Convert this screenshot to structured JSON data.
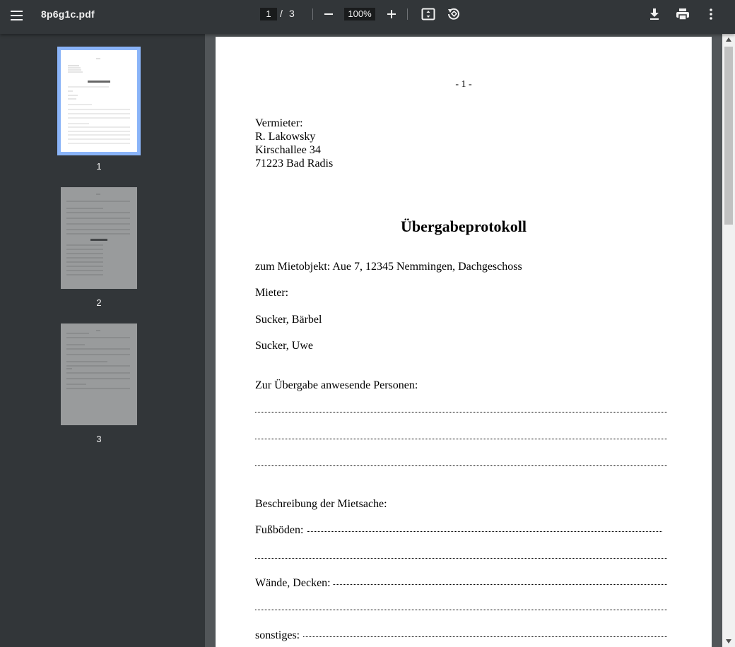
{
  "toolbar": {
    "filename": "8p6g1c.pdf",
    "current_page": "1",
    "page_separator": "/",
    "total_pages": "3",
    "zoom": "100%",
    "icons": [
      "menu-icon",
      "zoom-out-icon",
      "zoom-in-icon",
      "fit-page-icon",
      "rotate-icon",
      "download-icon",
      "print-icon",
      "more-vert-icon"
    ]
  },
  "sidebar": {
    "thumbnails": [
      {
        "label": "1"
      },
      {
        "label": "2"
      },
      {
        "label": "3"
      }
    ]
  },
  "document": {
    "page_number": "- 1 -",
    "landlord": {
      "heading": "Vermieter:",
      "name": "R. Lakowsky",
      "street": "Kirschallee 34",
      "city": "71223 Bad Radis"
    },
    "title": "Übergabeprotokoll",
    "object": "zum Mietobjekt: Aue 7, 12345 Nemmingen, Dachgeschoss",
    "tenant_heading": "Mieter:",
    "tenants": [
      "Sucker, Bärbel",
      "Sucker, Uwe"
    ],
    "present_heading": "Zur Übergabe anwesende Personen:",
    "description_heading": "Beschreibung der Mietsache:",
    "floors_label": "Fußböden:",
    "walls_label": "Wände, Decken:",
    "other_label": "sonstiges:"
  },
  "colors": {
    "toolbar_bg": "#323639",
    "viewer_bg": "#525659",
    "active_thumb_outline": "#8ab4f8"
  }
}
